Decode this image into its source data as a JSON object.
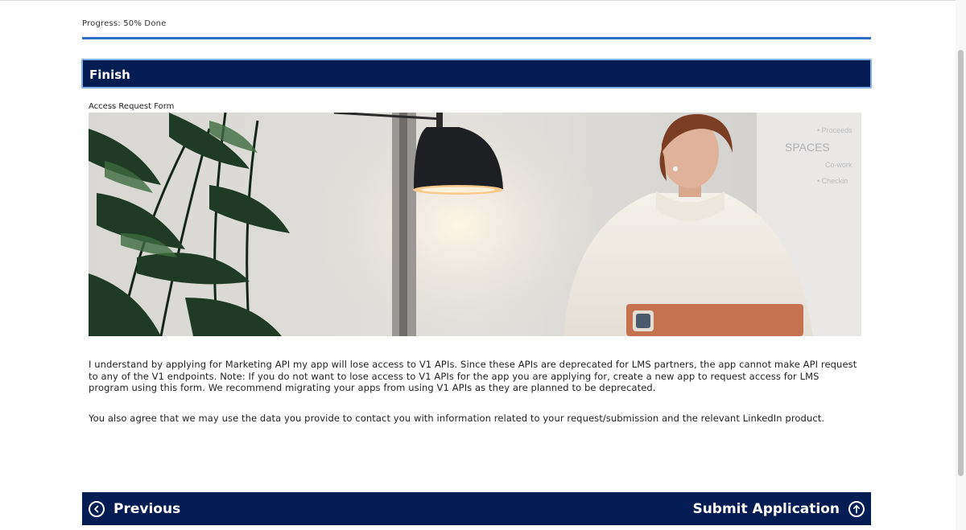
{
  "progress": {
    "label": "Progress: 50% Done",
    "percent": 50
  },
  "section": {
    "title": "Finish"
  },
  "form": {
    "label": "Access Request Form",
    "paragraph1": "I understand by applying for Marketing API my app will lose access to V1 APIs. Since these APIs are deprecated for LMS partners, the app cannot make API request to any of the V1 endpoints. Note: If you do not want to lose access to V1 APIs for the app you are applying for, create a new app to request access for LMS program using this form. We recommend migrating your apps from using V1 APIs as they are planned to be deprecated.",
    "paragraph2": "You also agree that we may use the data you provide to contact you with information related to your request/submission and the relevant LinkedIn product."
  },
  "footer": {
    "previous_label": "Previous",
    "submit_label": "Submit Application",
    "previous_icon": "chevron-left-circle-icon",
    "submit_icon": "arrow-up-circle-icon"
  },
  "colors": {
    "header_bg": "#031d52",
    "header_border": "#7db0ee",
    "progress_fill": "#2e6fc6"
  }
}
